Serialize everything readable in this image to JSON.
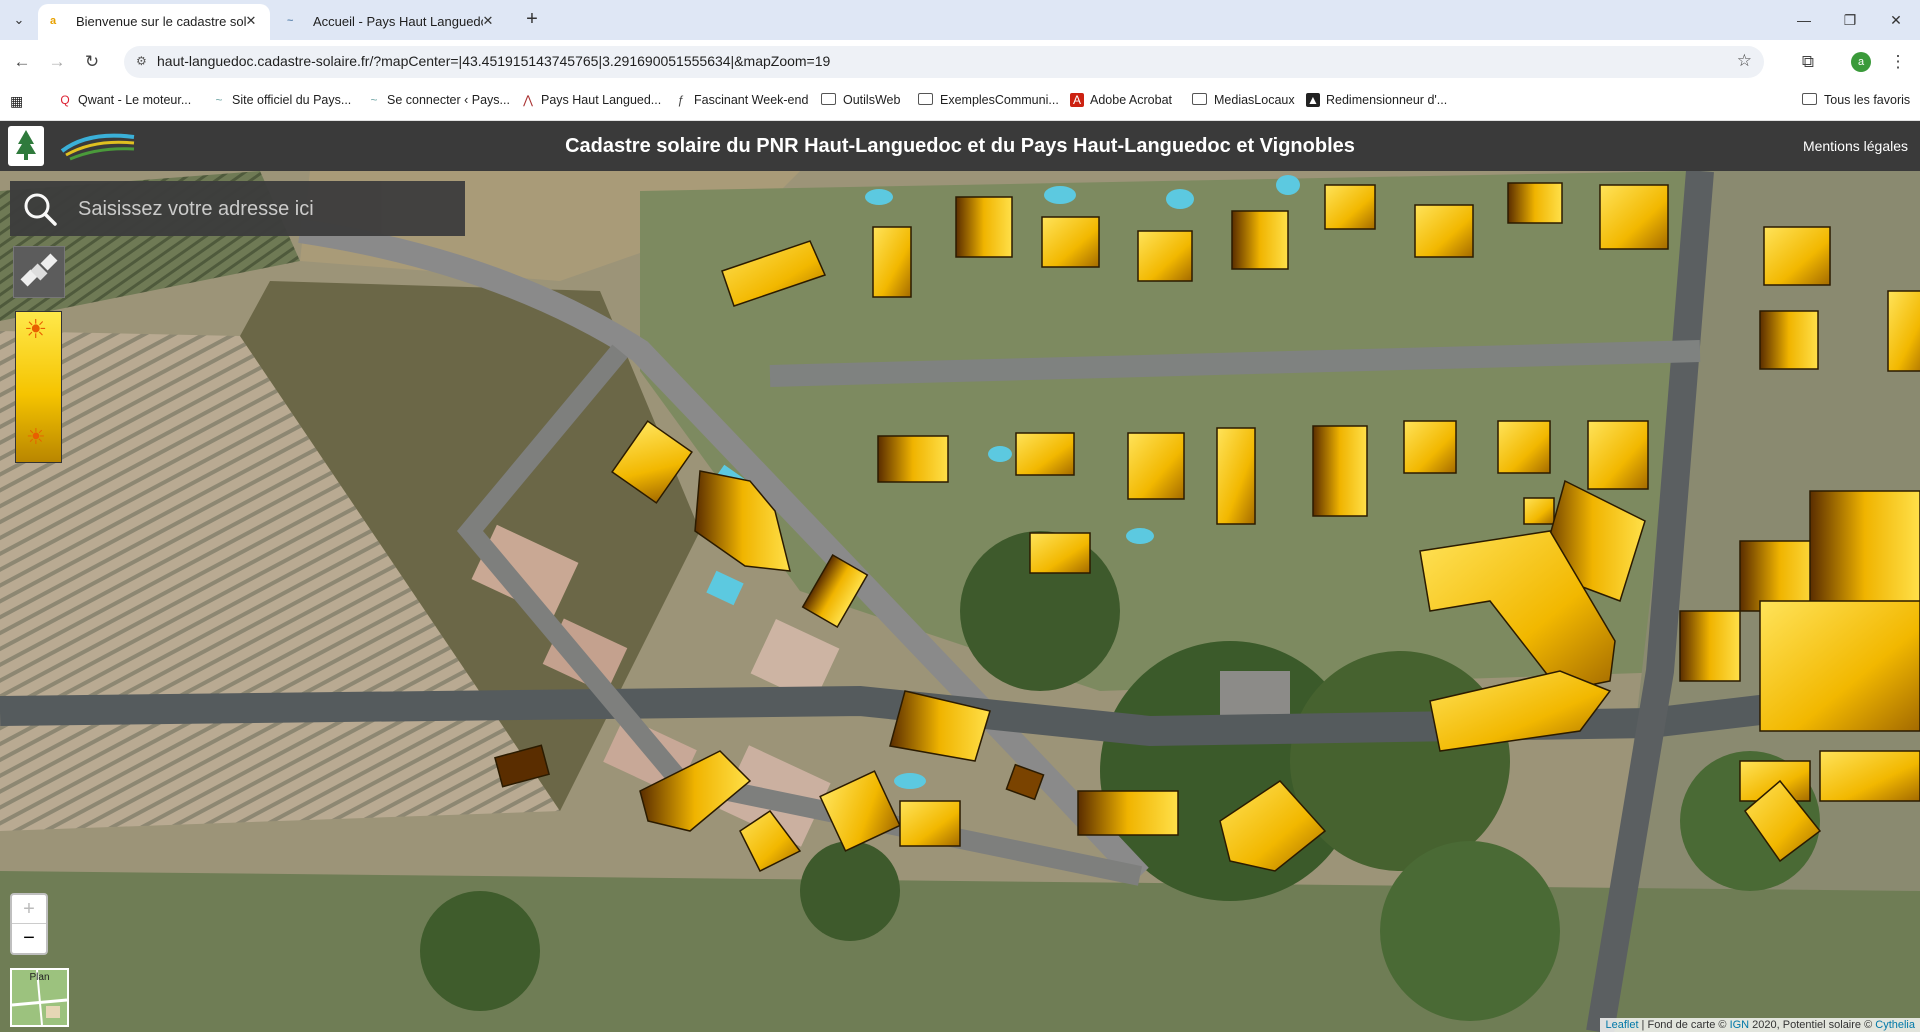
{
  "browser": {
    "tabs": [
      {
        "title": "Bienvenue sur le cadastre solaire",
        "favicon_text": "a",
        "active": true
      },
      {
        "title": "Accueil - Pays Haut Languedoc",
        "favicon_text": "~",
        "active": false
      }
    ],
    "url": "haut-languedoc.cadastre-solaire.fr/?mapCenter=|43.451915143745765|3.291690051555634|&mapZoom=19",
    "profile_initial": "a",
    "bookmarks": [
      {
        "label": "Qwant - Le moteur...",
        "icon": "qwant-icon"
      },
      {
        "label": "Site officiel du Pays...",
        "icon": "site-icon"
      },
      {
        "label": "Se connecter ‹ Pays...",
        "icon": "site-icon"
      },
      {
        "label": "Pays Haut Langued...",
        "icon": "site-icon"
      },
      {
        "label": "Fascinant Week-end",
        "icon": "site-icon"
      },
      {
        "label": "OutilsWeb",
        "icon": "folder-icon"
      },
      {
        "label": "ExemplesCommuni...",
        "icon": "folder-icon"
      },
      {
        "label": "Adobe Acrobat",
        "icon": "acrobat-icon"
      },
      {
        "label": "MediasLocaux",
        "icon": "folder-icon"
      },
      {
        "label": "Redimensionneur d'...",
        "icon": "app-icon"
      }
    ],
    "all_bookmarks_label": "Tous les favoris"
  },
  "site": {
    "title": "Cadastre solaire du PNR Haut-Languedoc et du Pays Haut-Languedoc et Vignobles",
    "mentions": "Mentions légales",
    "search_placeholder": "Saisissez votre adresse ici"
  },
  "map": {
    "zoom_in": "+",
    "zoom_out": "−",
    "minimap_label": "Plan",
    "attribution": {
      "leaflet": "Leaflet",
      "sep1": " | Fond de carte © ",
      "ign": "IGN",
      "mid": " 2020, Potentiel solaire © ",
      "cythelia": "Cythelia"
    },
    "colors": {
      "solar_high": "#ffd21a",
      "solar_low": "#5a2d00",
      "header": "#3a3a3a"
    }
  }
}
